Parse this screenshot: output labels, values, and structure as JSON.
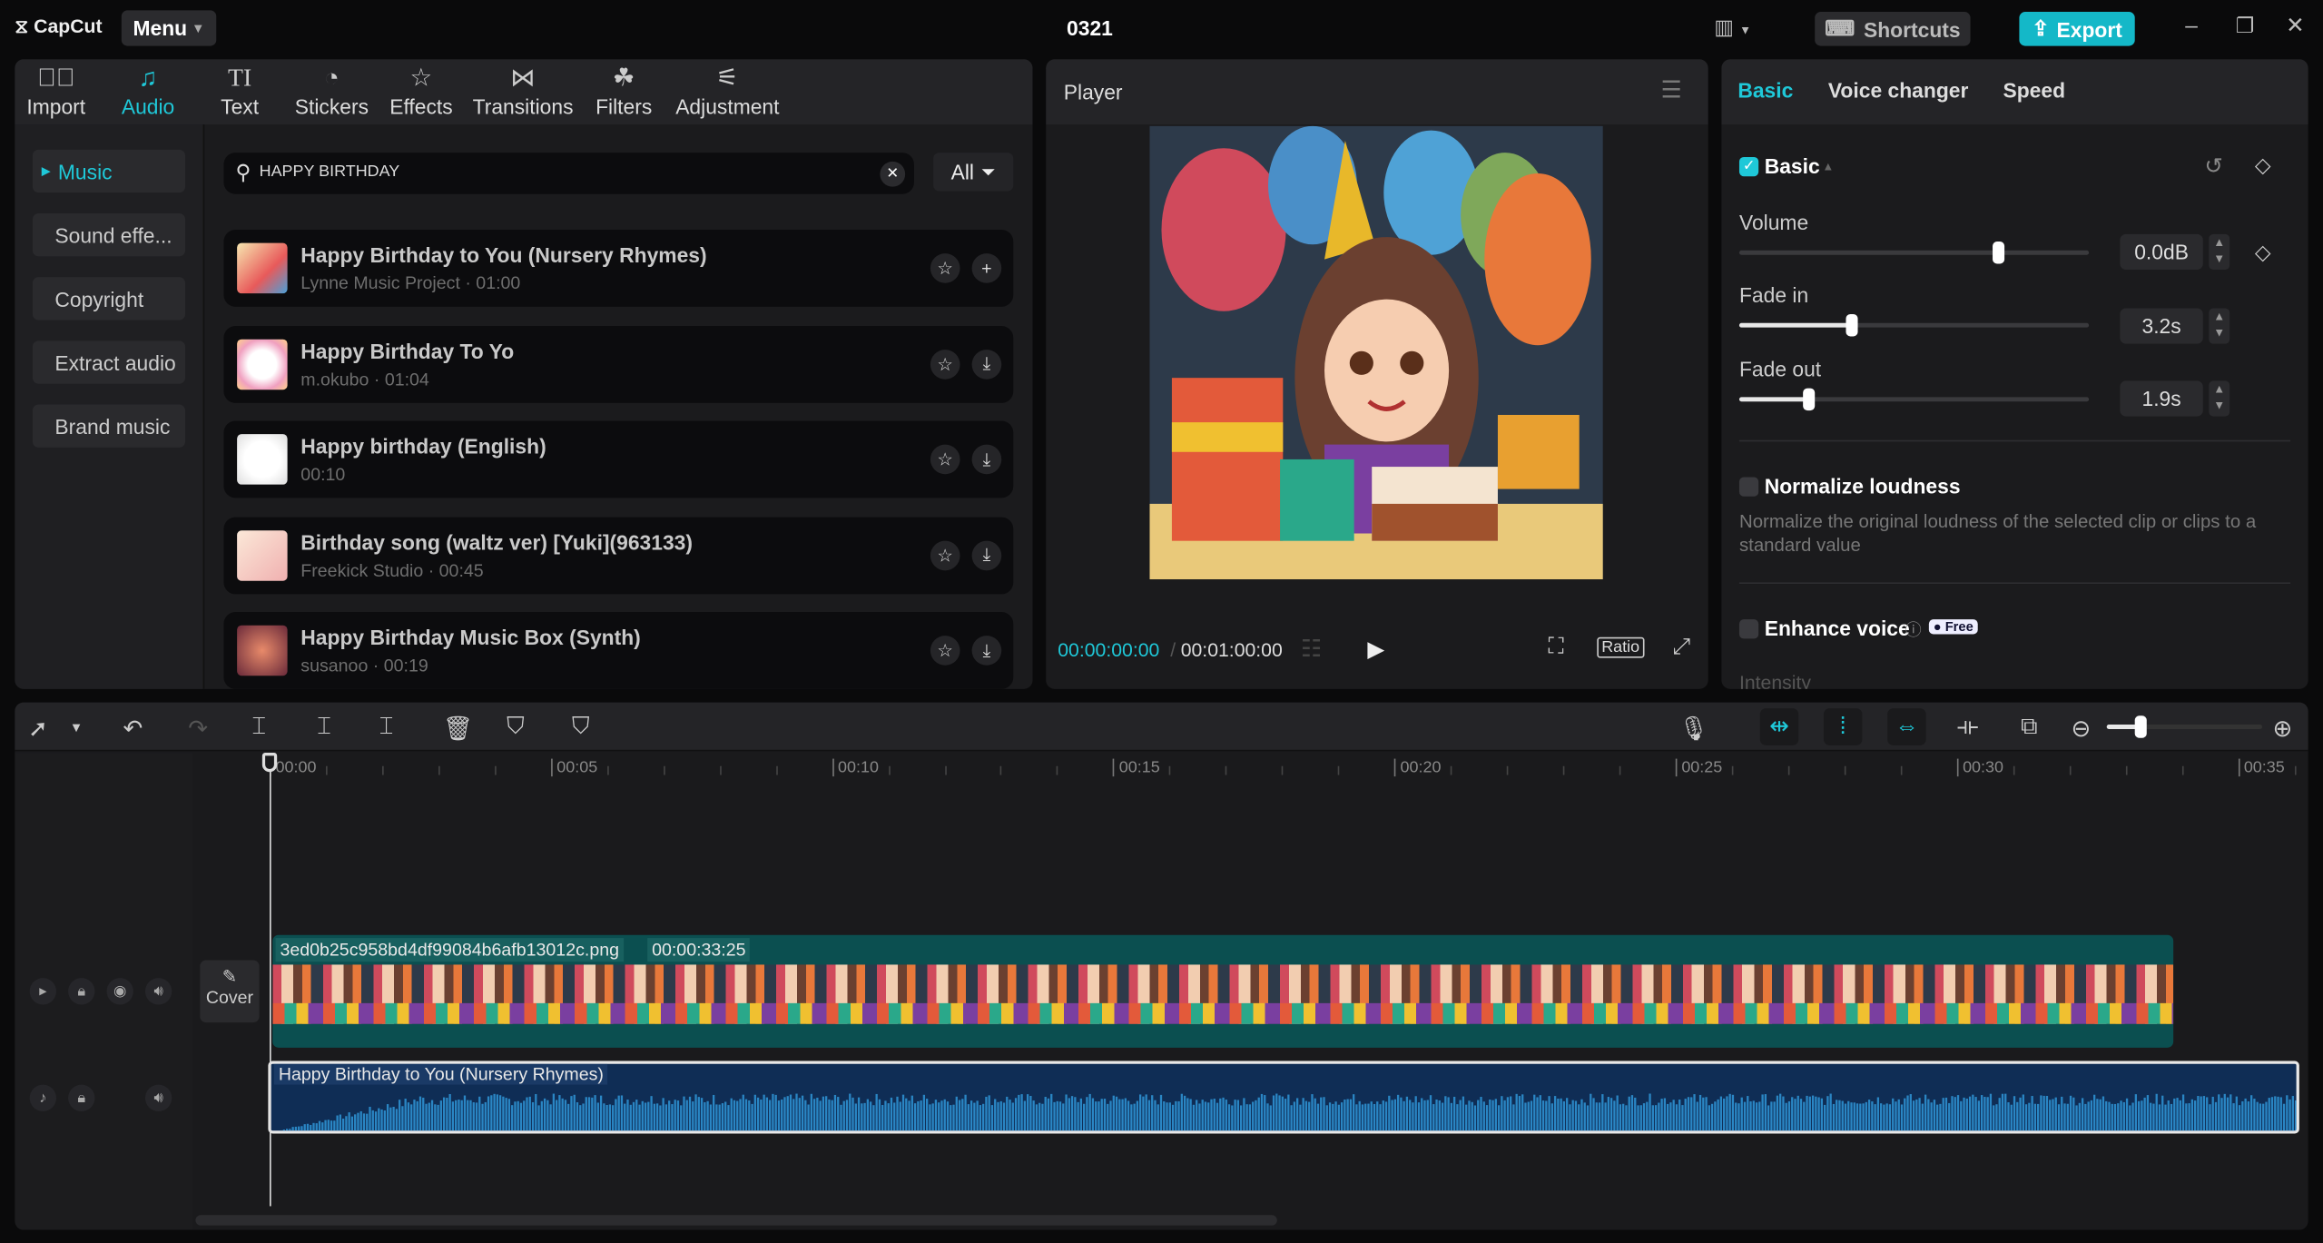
{
  "app": {
    "logo": "CapCut",
    "menu": "Menu",
    "project_title": "0321",
    "shortcuts": "Shortcuts",
    "export": "Export"
  },
  "colors": {
    "accent": "#1fc8d8",
    "export_bg": "#14b8c8",
    "video_clip": "#0b4f50",
    "audio_clip": "#0f2d55",
    "waveform": "#2a86c4"
  },
  "media_tabs": [
    {
      "label": "Import",
      "icon": "import-icon"
    },
    {
      "label": "Audio",
      "icon": "music-note-icon"
    },
    {
      "label": "Text",
      "icon": "text-icon"
    },
    {
      "label": "Stickers",
      "icon": "sticker-icon"
    },
    {
      "label": "Effects",
      "icon": "effects-star-icon"
    },
    {
      "label": "Transitions",
      "icon": "transition-icon"
    },
    {
      "label": "Filters",
      "icon": "filters-icon"
    },
    {
      "label": "Adjustment",
      "icon": "adjustment-icon"
    }
  ],
  "audio_sidebar": [
    {
      "label": "Music"
    },
    {
      "label": "Sound effe..."
    },
    {
      "label": "Copyright"
    },
    {
      "label": "Extract audio"
    },
    {
      "label": "Brand music"
    }
  ],
  "search": {
    "value": "HAPPY BIRTHDAY",
    "filter": "All"
  },
  "music_list": [
    {
      "title": "Happy Birthday to You (Nursery Rhymes)",
      "sub": "Lynne Music Project · 01:00",
      "action": "+"
    },
    {
      "title": "Happy Birthday To Yo",
      "sub": "m.okubo · 01:04",
      "action": "⤓"
    },
    {
      "title": "Happy birthday (English)",
      "sub": "00:10",
      "action": "⤓"
    },
    {
      "title": "Birthday song (waltz ver) [Yuki](963133)",
      "sub": "Freekick Studio · 00:45",
      "action": "⤓"
    },
    {
      "title": "Happy Birthday Music Box (Synth)",
      "sub": "susanoo · 00:19",
      "action": "⤓"
    }
  ],
  "player": {
    "title": "Player",
    "current_time": "00:00:00:00",
    "total_time": "00:01:00:00",
    "ratio": "Ratio"
  },
  "properties": {
    "tabs": [
      "Basic",
      "Voice changer",
      "Speed"
    ],
    "section": "Basic",
    "volume": {
      "label": "Volume",
      "value": "0.0dB",
      "fraction": 0.74
    },
    "fade_in": {
      "label": "Fade in",
      "value": "3.2s",
      "fraction": 0.32
    },
    "fade_out": {
      "label": "Fade out",
      "value": "1.9s",
      "fraction": 0.2
    },
    "normalize": {
      "label": "Normalize loudness",
      "desc": "Normalize the original loudness of the selected clip or clips to a standard value"
    },
    "enhance": {
      "label": "Enhance voice",
      "badge": "Free"
    },
    "intensity": "Intensity"
  },
  "timeline": {
    "ticks": [
      "00:00",
      "00:05",
      "00:10",
      "00:15",
      "00:20",
      "00:25",
      "00:30",
      "00:35"
    ],
    "cover": "Cover",
    "video_clip": {
      "name": "3ed0b25c958bd4df99084b6afb13012c.png",
      "duration": "00:00:33:25"
    },
    "audio_clip": {
      "name": "Happy Birthday to You (Nursery Rhymes)"
    }
  }
}
